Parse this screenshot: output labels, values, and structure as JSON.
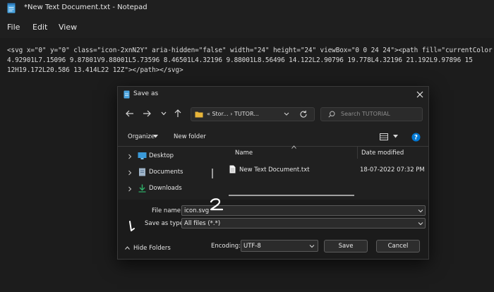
{
  "notepad": {
    "title": "*New Text Document.txt - Notepad",
    "menu": [
      "File",
      "Edit",
      "View"
    ],
    "lines": [
      "<svg x=\"0\" y=\"0\" class=\"icon-2xnN2Y\" aria-hidden=\"false\" width=\"24\" height=\"24\" viewBox=\"0 0 24 24\"><path fill=\"currentColor",
      "4.92901L7.15096 9.87801V9.88001L5.73596 8.46501L4.32196 9.88001L8.56496 14.122L2.90796 19.778L4.32196 21.192L9.97896 15",
      "12H19.172L20.586 13.414L22 12Z\"></path></svg>"
    ]
  },
  "dialog": {
    "title": "Save as",
    "address": {
      "prefix": "«",
      "crumb1": "Stor...",
      "separator": "›",
      "crumb2": "TUTOR..."
    },
    "search_placeholder": "Search TUTORIAL",
    "toolbar": {
      "organize": "Organize",
      "new_folder": "New folder"
    },
    "sidebar": [
      {
        "label": "Desktop",
        "icon": "desktop-icon"
      },
      {
        "label": "Documents",
        "icon": "documents-icon"
      },
      {
        "label": "Downloads",
        "icon": "downloads-icon"
      }
    ],
    "columns": {
      "name": "Name",
      "date": "Date modified"
    },
    "files": [
      {
        "name": "New Text Document.txt",
        "date": "18-07-2022 07:32 PM"
      }
    ],
    "file_name_label": "File name:",
    "file_name_value": "icon.svg",
    "save_type_label": "Save as type:",
    "save_type_value": "All files  (*.*)",
    "hide_folders": "Hide Folders",
    "encoding_label": "Encoding:",
    "encoding_value": "UTF-8",
    "save_button": "Save",
    "cancel_button": "Cancel"
  },
  "annotation_mark": "2",
  "colors": {
    "accent": "#0078d4",
    "folder": "#e8b53a",
    "background": "#1c1c1c",
    "dialog": "#202020"
  }
}
